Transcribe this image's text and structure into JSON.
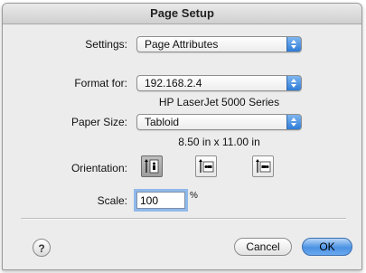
{
  "window": {
    "title": "Page Setup"
  },
  "settings": {
    "label": "Settings:",
    "value": "Page Attributes"
  },
  "format_for": {
    "label": "Format for:",
    "value": "192.168.2.4",
    "printer_model": "HP LaserJet 5000 Series"
  },
  "paper_size": {
    "label": "Paper Size:",
    "value": "Tabloid",
    "dimensions": "8.50 in x 11.00 in"
  },
  "orientation": {
    "label": "Orientation:",
    "options": [
      "portrait",
      "landscape-left",
      "landscape-right"
    ],
    "selected": "portrait"
  },
  "scale": {
    "label": "Scale:",
    "value": "100",
    "unit": "%"
  },
  "buttons": {
    "help": "?",
    "cancel": "Cancel",
    "ok": "OK"
  }
}
